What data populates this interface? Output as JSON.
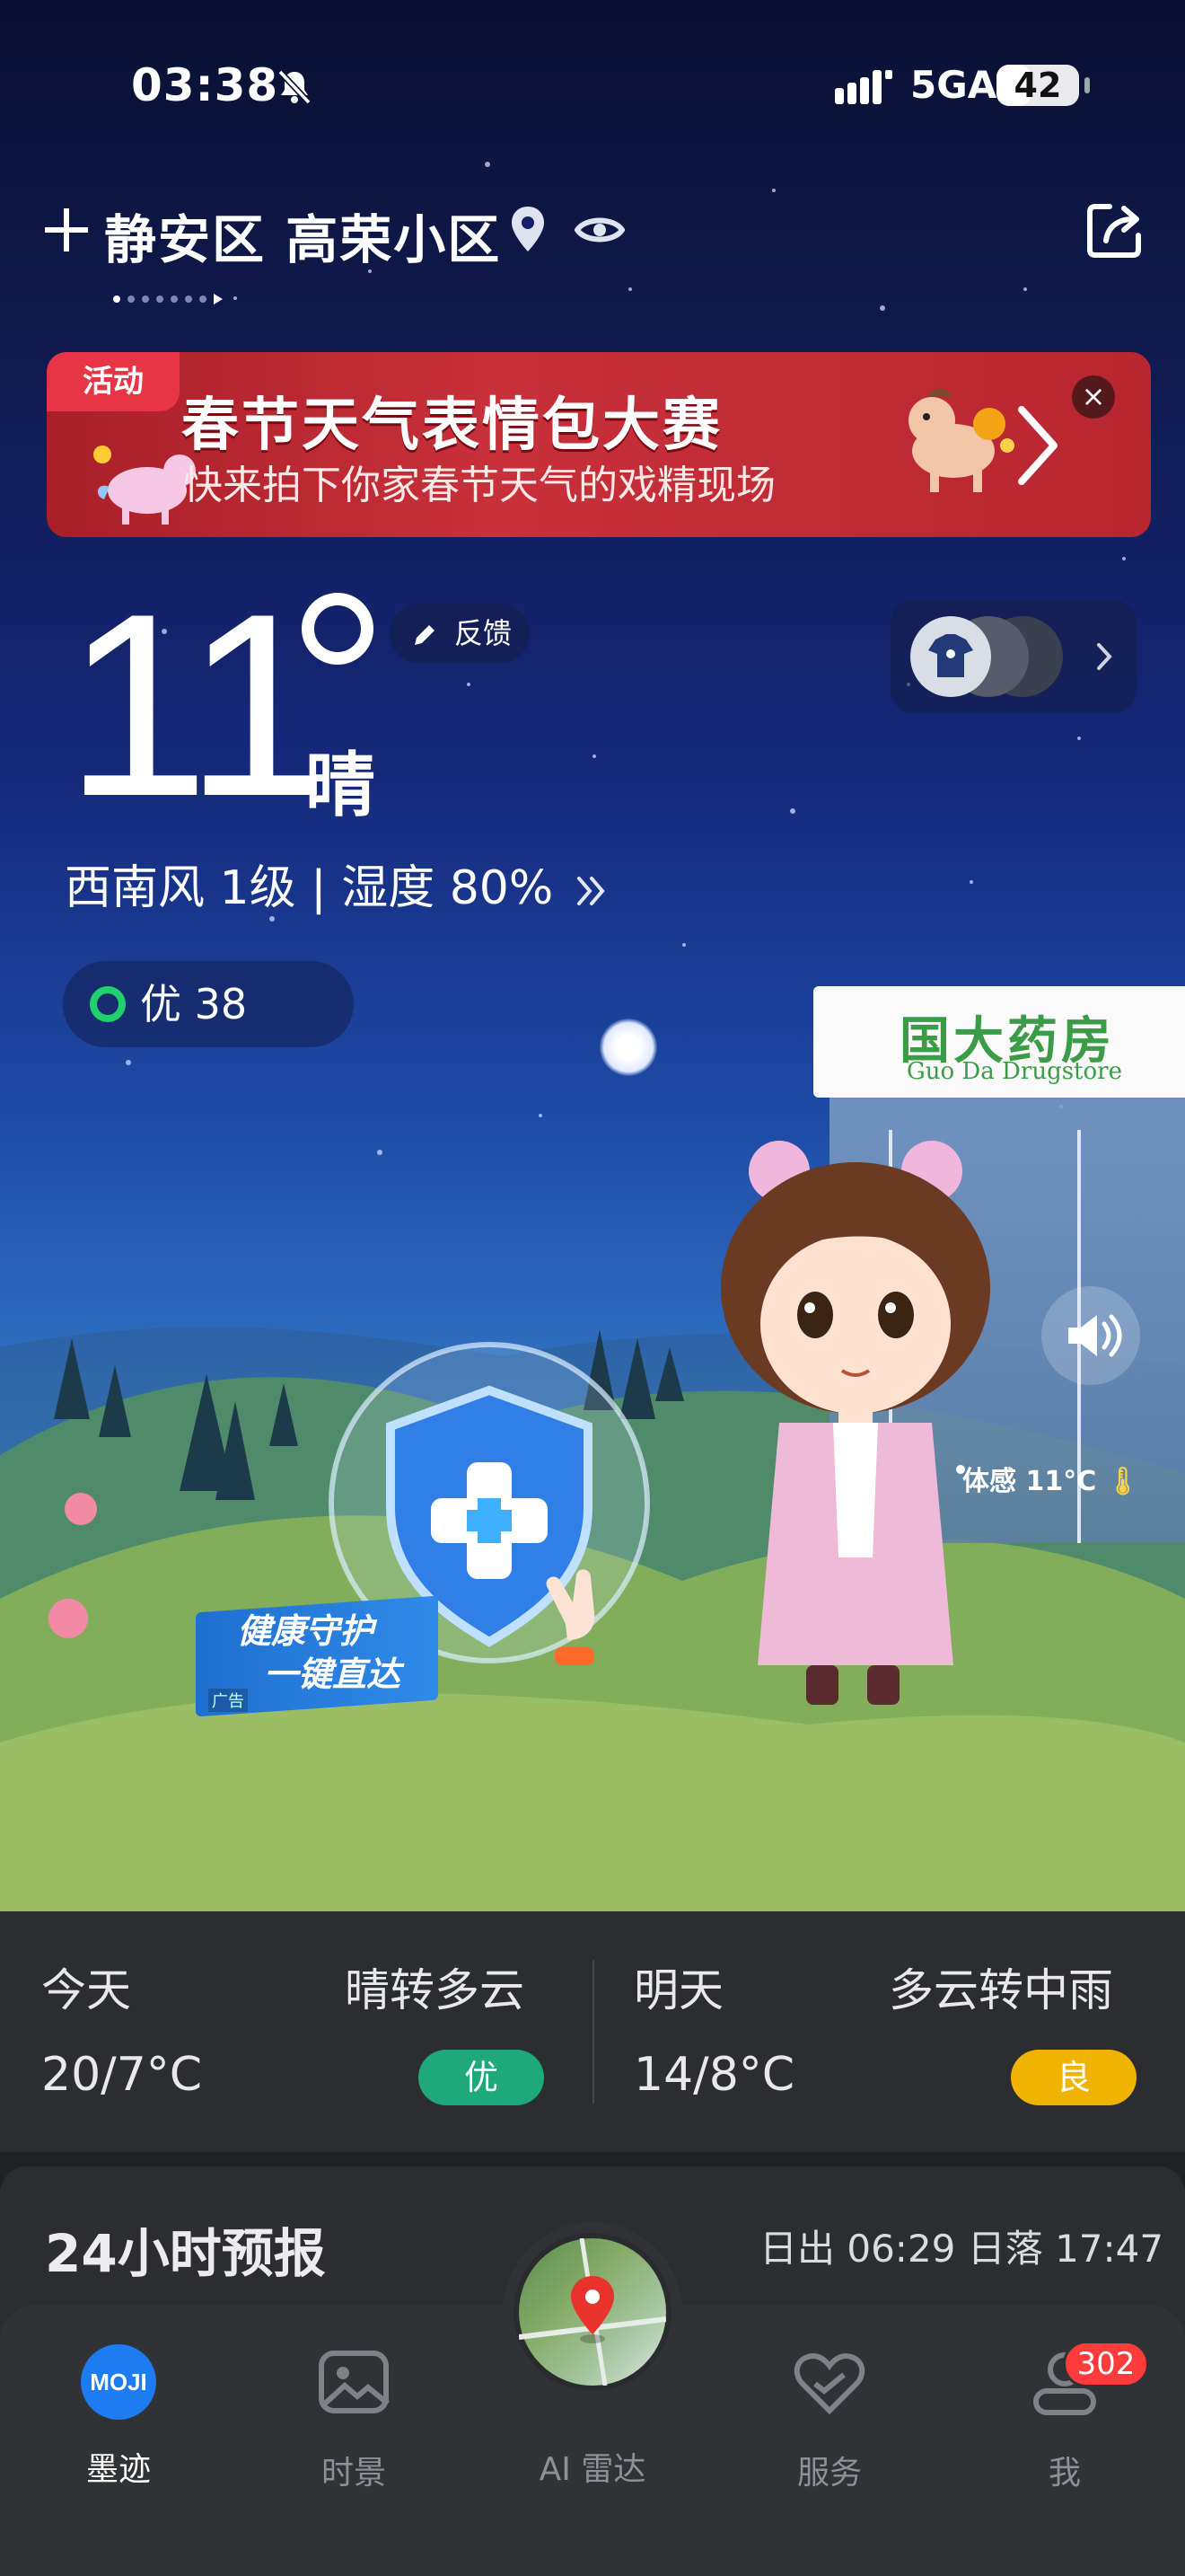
{
  "status_bar": {
    "time": "03:38",
    "network": "5GA",
    "battery": "42",
    "battery_level": 0.42,
    "bell_icon": "bell-muted-icon",
    "signal_icon": "signal-bars-icon"
  },
  "location": {
    "name": "静安区 高荣小区",
    "add_icon": "plus-icon",
    "pin_icon": "location-pin-icon",
    "eye_icon": "eye-icon",
    "share_icon": "share-icon"
  },
  "banner": {
    "tag": "活动",
    "title": "春节天气表情包大赛",
    "subtitle": "快来拍下你家春节天气的戏精现场",
    "close": "×"
  },
  "current": {
    "temperature": "11",
    "condition": "晴",
    "feedback_label": "反馈",
    "wind_humidity": "西南风 1级 | 湿度 80%",
    "aqi_label": "优 38"
  },
  "scene": {
    "store_name_cn": "国大药房",
    "store_name_en": "Guo Da Drugstore",
    "feels_like": "体感 11°C",
    "health_line1": "健康守护",
    "health_line2": "一键直达",
    "ad_tag": "广告"
  },
  "forecast": {
    "today": {
      "label": "今天",
      "condition": "晴转多云",
      "temps": "20/7°C",
      "aqi": "优",
      "aqi_color": "#1fa97a"
    },
    "tomorrow": {
      "label": "明天",
      "condition": "多云转中雨",
      "temps": "14/8°C",
      "aqi": "良",
      "aqi_color": "#f0b400"
    }
  },
  "hourly": {
    "title": "24小时预报",
    "sunrise_sunset": "日出 06:29  日落 17:47"
  },
  "tabbar": {
    "items": [
      {
        "label": "墨迹",
        "icon": "moji-logo-icon"
      },
      {
        "label": "时景",
        "icon": "photo-icon"
      },
      {
        "label": "AI 雷达",
        "icon": "radar-map-icon"
      },
      {
        "label": "服务",
        "icon": "heart-service-icon"
      },
      {
        "label": "我",
        "icon": "profile-icon"
      }
    ],
    "badge": "302"
  }
}
